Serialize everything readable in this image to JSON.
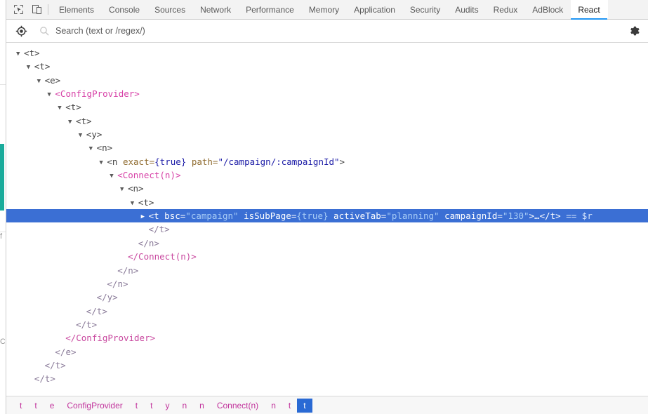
{
  "theme": {
    "accent": "#2196f3",
    "selection_bg": "#3b6fd4",
    "component_color": "#d741a7",
    "string_color": "#1a1aa6",
    "attr_color": "#8f6b2f",
    "teal_strip": "#1aab9b"
  },
  "toolbar": {
    "inspect_icon": "inspect-element-icon",
    "device_icon": "device-toolbar-icon",
    "tabs": [
      {
        "label": "Elements",
        "active": false
      },
      {
        "label": "Console",
        "active": false
      },
      {
        "label": "Sources",
        "active": false
      },
      {
        "label": "Network",
        "active": false
      },
      {
        "label": "Performance",
        "active": false
      },
      {
        "label": "Memory",
        "active": false
      },
      {
        "label": "Application",
        "active": false
      },
      {
        "label": "Security",
        "active": false
      },
      {
        "label": "Audits",
        "active": false
      },
      {
        "label": "Redux",
        "active": false
      },
      {
        "label": "AdBlock",
        "active": false
      },
      {
        "label": "React",
        "active": true
      }
    ]
  },
  "search": {
    "target_icon": "crosshair-target-icon",
    "magnifier_icon": "search-icon",
    "placeholder": "Search (text or /regex/)",
    "value": "",
    "gear_icon": "gear-icon"
  },
  "tree": {
    "nodes": [
      {
        "indent": 0,
        "arrow": "▼",
        "type": "open",
        "tag": "t"
      },
      {
        "indent": 1,
        "arrow": "▼",
        "type": "open",
        "tag": "t"
      },
      {
        "indent": 2,
        "arrow": "▼",
        "type": "open",
        "tag": "e"
      },
      {
        "indent": 3,
        "arrow": "▼",
        "type": "open-comp",
        "tag": "ConfigProvider"
      },
      {
        "indent": 4,
        "arrow": "▼",
        "type": "open",
        "tag": "t"
      },
      {
        "indent": 5,
        "arrow": "▼",
        "type": "open",
        "tag": "t"
      },
      {
        "indent": 6,
        "arrow": "▼",
        "type": "open",
        "tag": "y"
      },
      {
        "indent": 7,
        "arrow": "▼",
        "type": "open",
        "tag": "n"
      },
      {
        "indent": 8,
        "arrow": "▼",
        "type": "open-attrs",
        "tag": "n",
        "attrs": [
          {
            "name": "exact",
            "value": "{true}",
            "kind": "brace"
          },
          {
            "name": "path",
            "value": "\"/campaign/:campaignId\"",
            "kind": "string"
          }
        ]
      },
      {
        "indent": 9,
        "arrow": "▼",
        "type": "open-comp",
        "tag": "Connect(n)"
      },
      {
        "indent": 10,
        "arrow": "▼",
        "type": "open",
        "tag": "n"
      },
      {
        "indent": 11,
        "arrow": "▼",
        "type": "open",
        "tag": "t"
      },
      {
        "indent": 12,
        "arrow": "▶",
        "type": "selected",
        "tag": "t",
        "attrs": [
          {
            "name": "bsc",
            "value": "\"campaign\"",
            "kind": "string"
          },
          {
            "name": "isSubPage",
            "value": "{true}",
            "kind": "brace"
          },
          {
            "name": "activeTab",
            "value": "\"planning\"",
            "kind": "string"
          },
          {
            "name": "campaignId",
            "value": "\"130\"",
            "kind": "string"
          }
        ],
        "collapsed_suffix": ">…</t>",
        "ref": "== $r"
      },
      {
        "indent": 12,
        "arrow": "",
        "type": "close",
        "tag": "t"
      },
      {
        "indent": 11,
        "arrow": "",
        "type": "close",
        "tag": "n"
      },
      {
        "indent": 10,
        "arrow": "",
        "type": "close-comp",
        "tag": "Connect(n)"
      },
      {
        "indent": 9,
        "arrow": "",
        "type": "close",
        "tag": "n"
      },
      {
        "indent": 8,
        "arrow": "",
        "type": "close",
        "tag": "n"
      },
      {
        "indent": 7,
        "arrow": "",
        "type": "close",
        "tag": "y"
      },
      {
        "indent": 6,
        "arrow": "",
        "type": "close",
        "tag": "t"
      },
      {
        "indent": 5,
        "arrow": "",
        "type": "close",
        "tag": "t"
      },
      {
        "indent": 4,
        "arrow": "",
        "type": "close-comp",
        "tag": "ConfigProvider"
      },
      {
        "indent": 3,
        "arrow": "",
        "type": "close",
        "tag": "e"
      },
      {
        "indent": 2,
        "arrow": "",
        "type": "close",
        "tag": "t"
      },
      {
        "indent": 1,
        "arrow": "",
        "type": "close",
        "tag": "t"
      }
    ]
  },
  "breadcrumb": {
    "items": [
      {
        "label": "t",
        "selected": false
      },
      {
        "label": "t",
        "selected": false
      },
      {
        "label": "e",
        "selected": false
      },
      {
        "label": "ConfigProvider",
        "selected": false
      },
      {
        "label": "t",
        "selected": false
      },
      {
        "label": "t",
        "selected": false
      },
      {
        "label": "y",
        "selected": false
      },
      {
        "label": "n",
        "selected": false
      },
      {
        "label": "n",
        "selected": false
      },
      {
        "label": "Connect(n)",
        "selected": false
      },
      {
        "label": "n",
        "selected": false
      },
      {
        "label": "t",
        "selected": false
      },
      {
        "label": "t",
        "selected": true
      }
    ]
  }
}
